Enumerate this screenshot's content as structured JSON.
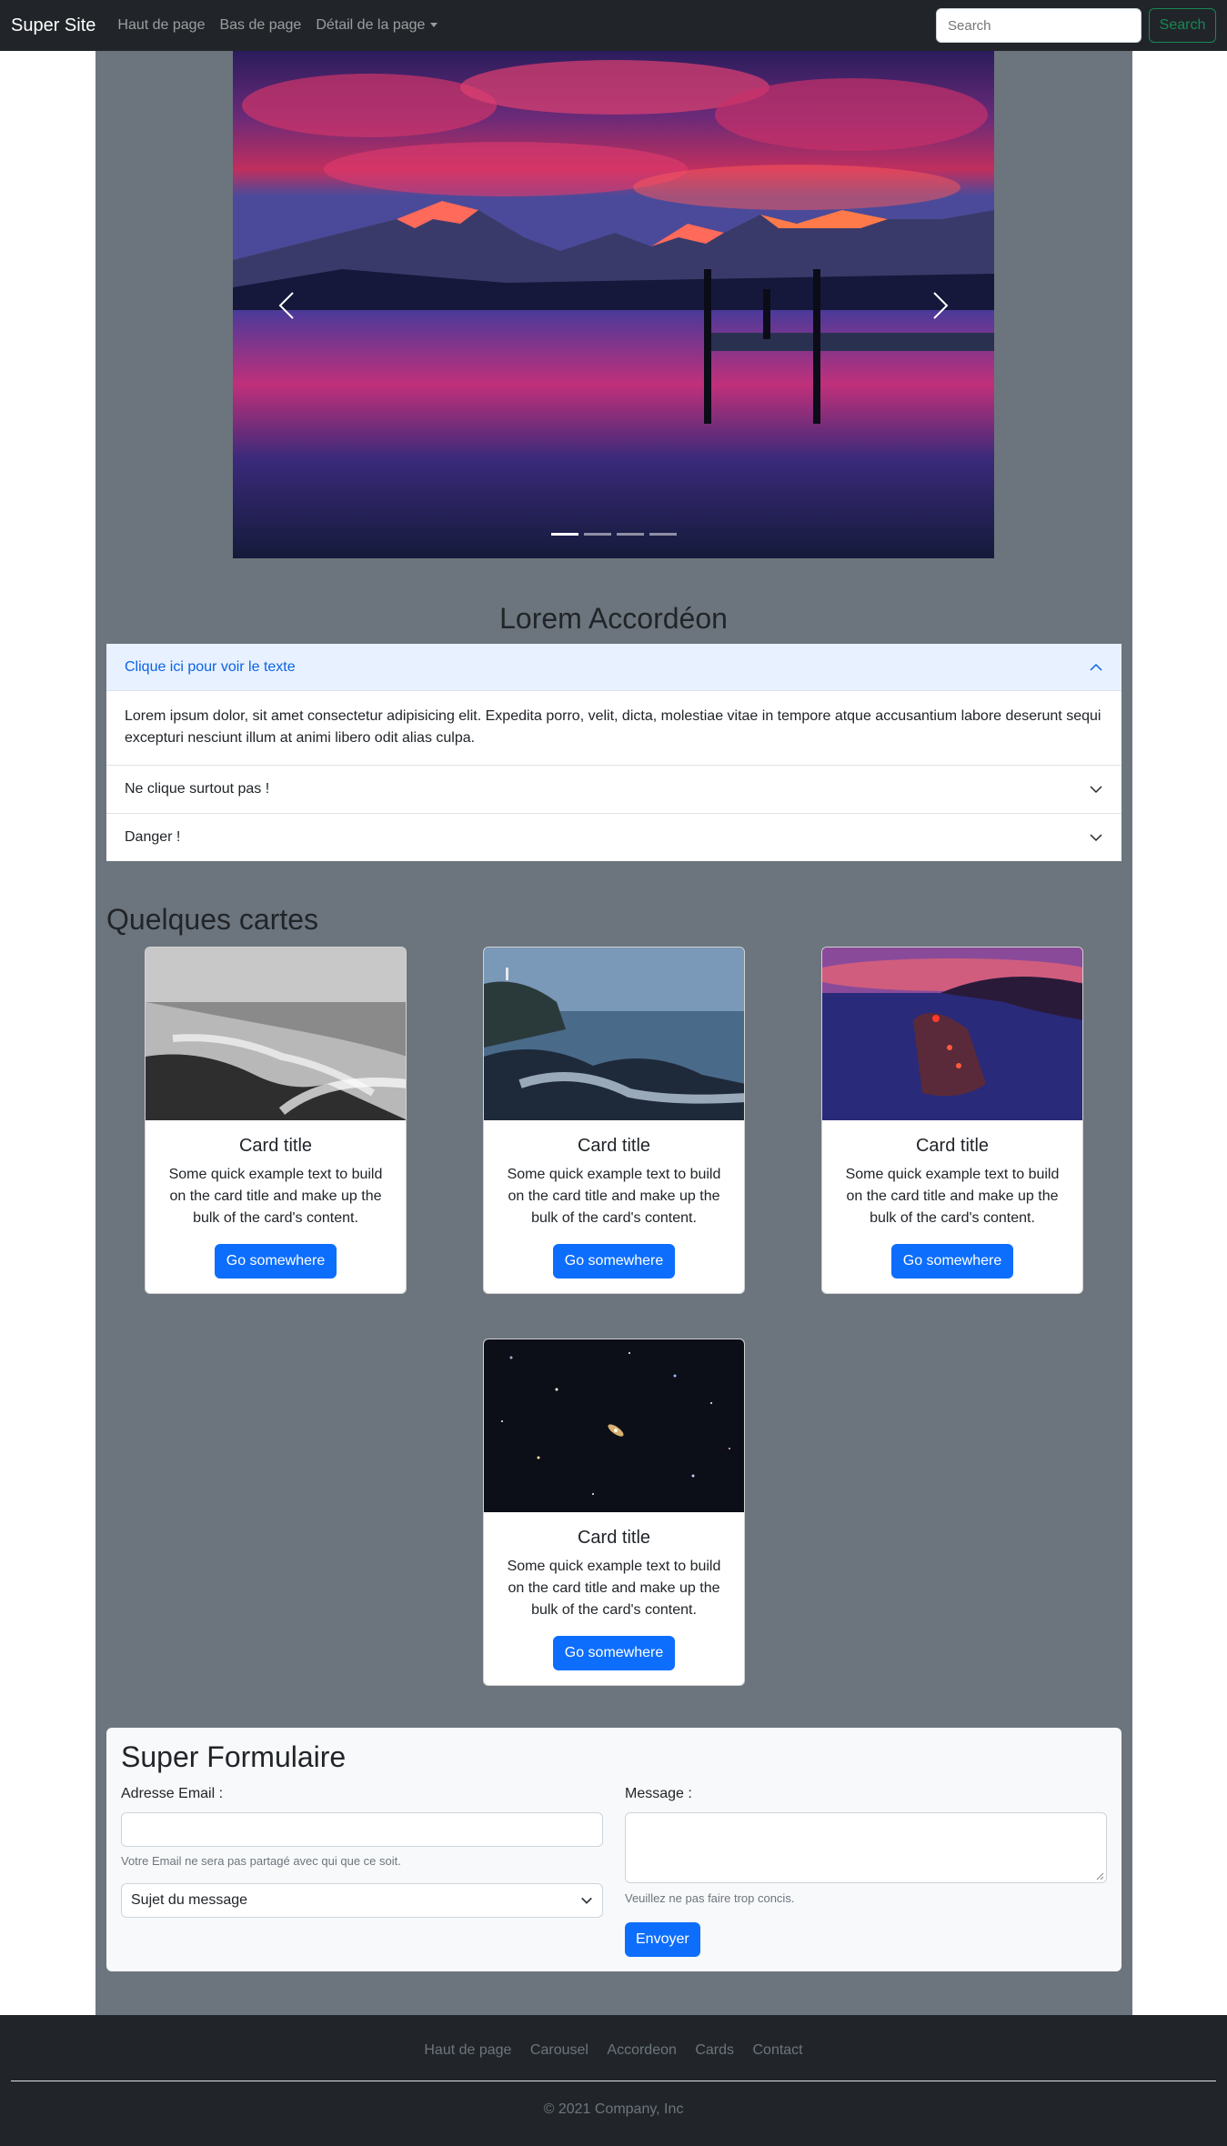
{
  "navbar": {
    "brand": "Super Site",
    "links": [
      "Haut de page",
      "Bas de page",
      "Détail de la page"
    ],
    "search_placeholder": "Search",
    "search_button": "Search"
  },
  "carousel": {
    "slide_count": 4,
    "active_index": 0
  },
  "accordion": {
    "title": "Lorem Accordéon",
    "items": [
      {
        "header": "Clique ici pour voir le texte",
        "body": "Lorem ipsum dolor, sit amet consectetur adipisicing elit. Expedita porro, velit, dicta, molestiae vitae in tempore atque accusantium labore deserunt sequi excepturi nesciunt illum at animi libero odit alias culpa.",
        "open": true
      },
      {
        "header": "Ne clique surtout pas !",
        "open": false
      },
      {
        "header": "Danger !",
        "open": false
      }
    ]
  },
  "cards": {
    "title": "Quelques cartes",
    "items": [
      {
        "title": "Card title",
        "text": "Some quick example text to build on the card title and make up the bulk of the card's content.",
        "button": "Go somewhere"
      },
      {
        "title": "Card title",
        "text": "Some quick example text to build on the card title and make up the bulk of the card's content.",
        "button": "Go somewhere"
      },
      {
        "title": "Card title",
        "text": "Some quick example text to build on the card title and make up the bulk of the card's content.",
        "button": "Go somewhere"
      },
      {
        "title": "Card title",
        "text": "Some quick example text to build on the card title and make up the bulk of the card's content.",
        "button": "Go somewhere"
      }
    ]
  },
  "form": {
    "title": "Super Formulaire",
    "email_label": "Adresse Email :",
    "email_value": "",
    "email_help": "Votre Email ne sera pas partagé avec qui que ce soit.",
    "select_value": "Sujet du message",
    "message_label": "Message :",
    "message_value": "",
    "message_help": "Veuillez ne pas faire trop concis.",
    "submit": "Envoyer"
  },
  "footer": {
    "links": [
      "Haut de page",
      "Carousel",
      "Accordeon",
      "Cards",
      "Contact"
    ],
    "copyright": "© 2021 Company, Inc"
  },
  "colors": {
    "navbar_bg": "#212529",
    "main_bg": "#6c757d",
    "primary": "#0d6efd",
    "success": "#198754",
    "accordion_open_bg": "#e7f1ff"
  }
}
